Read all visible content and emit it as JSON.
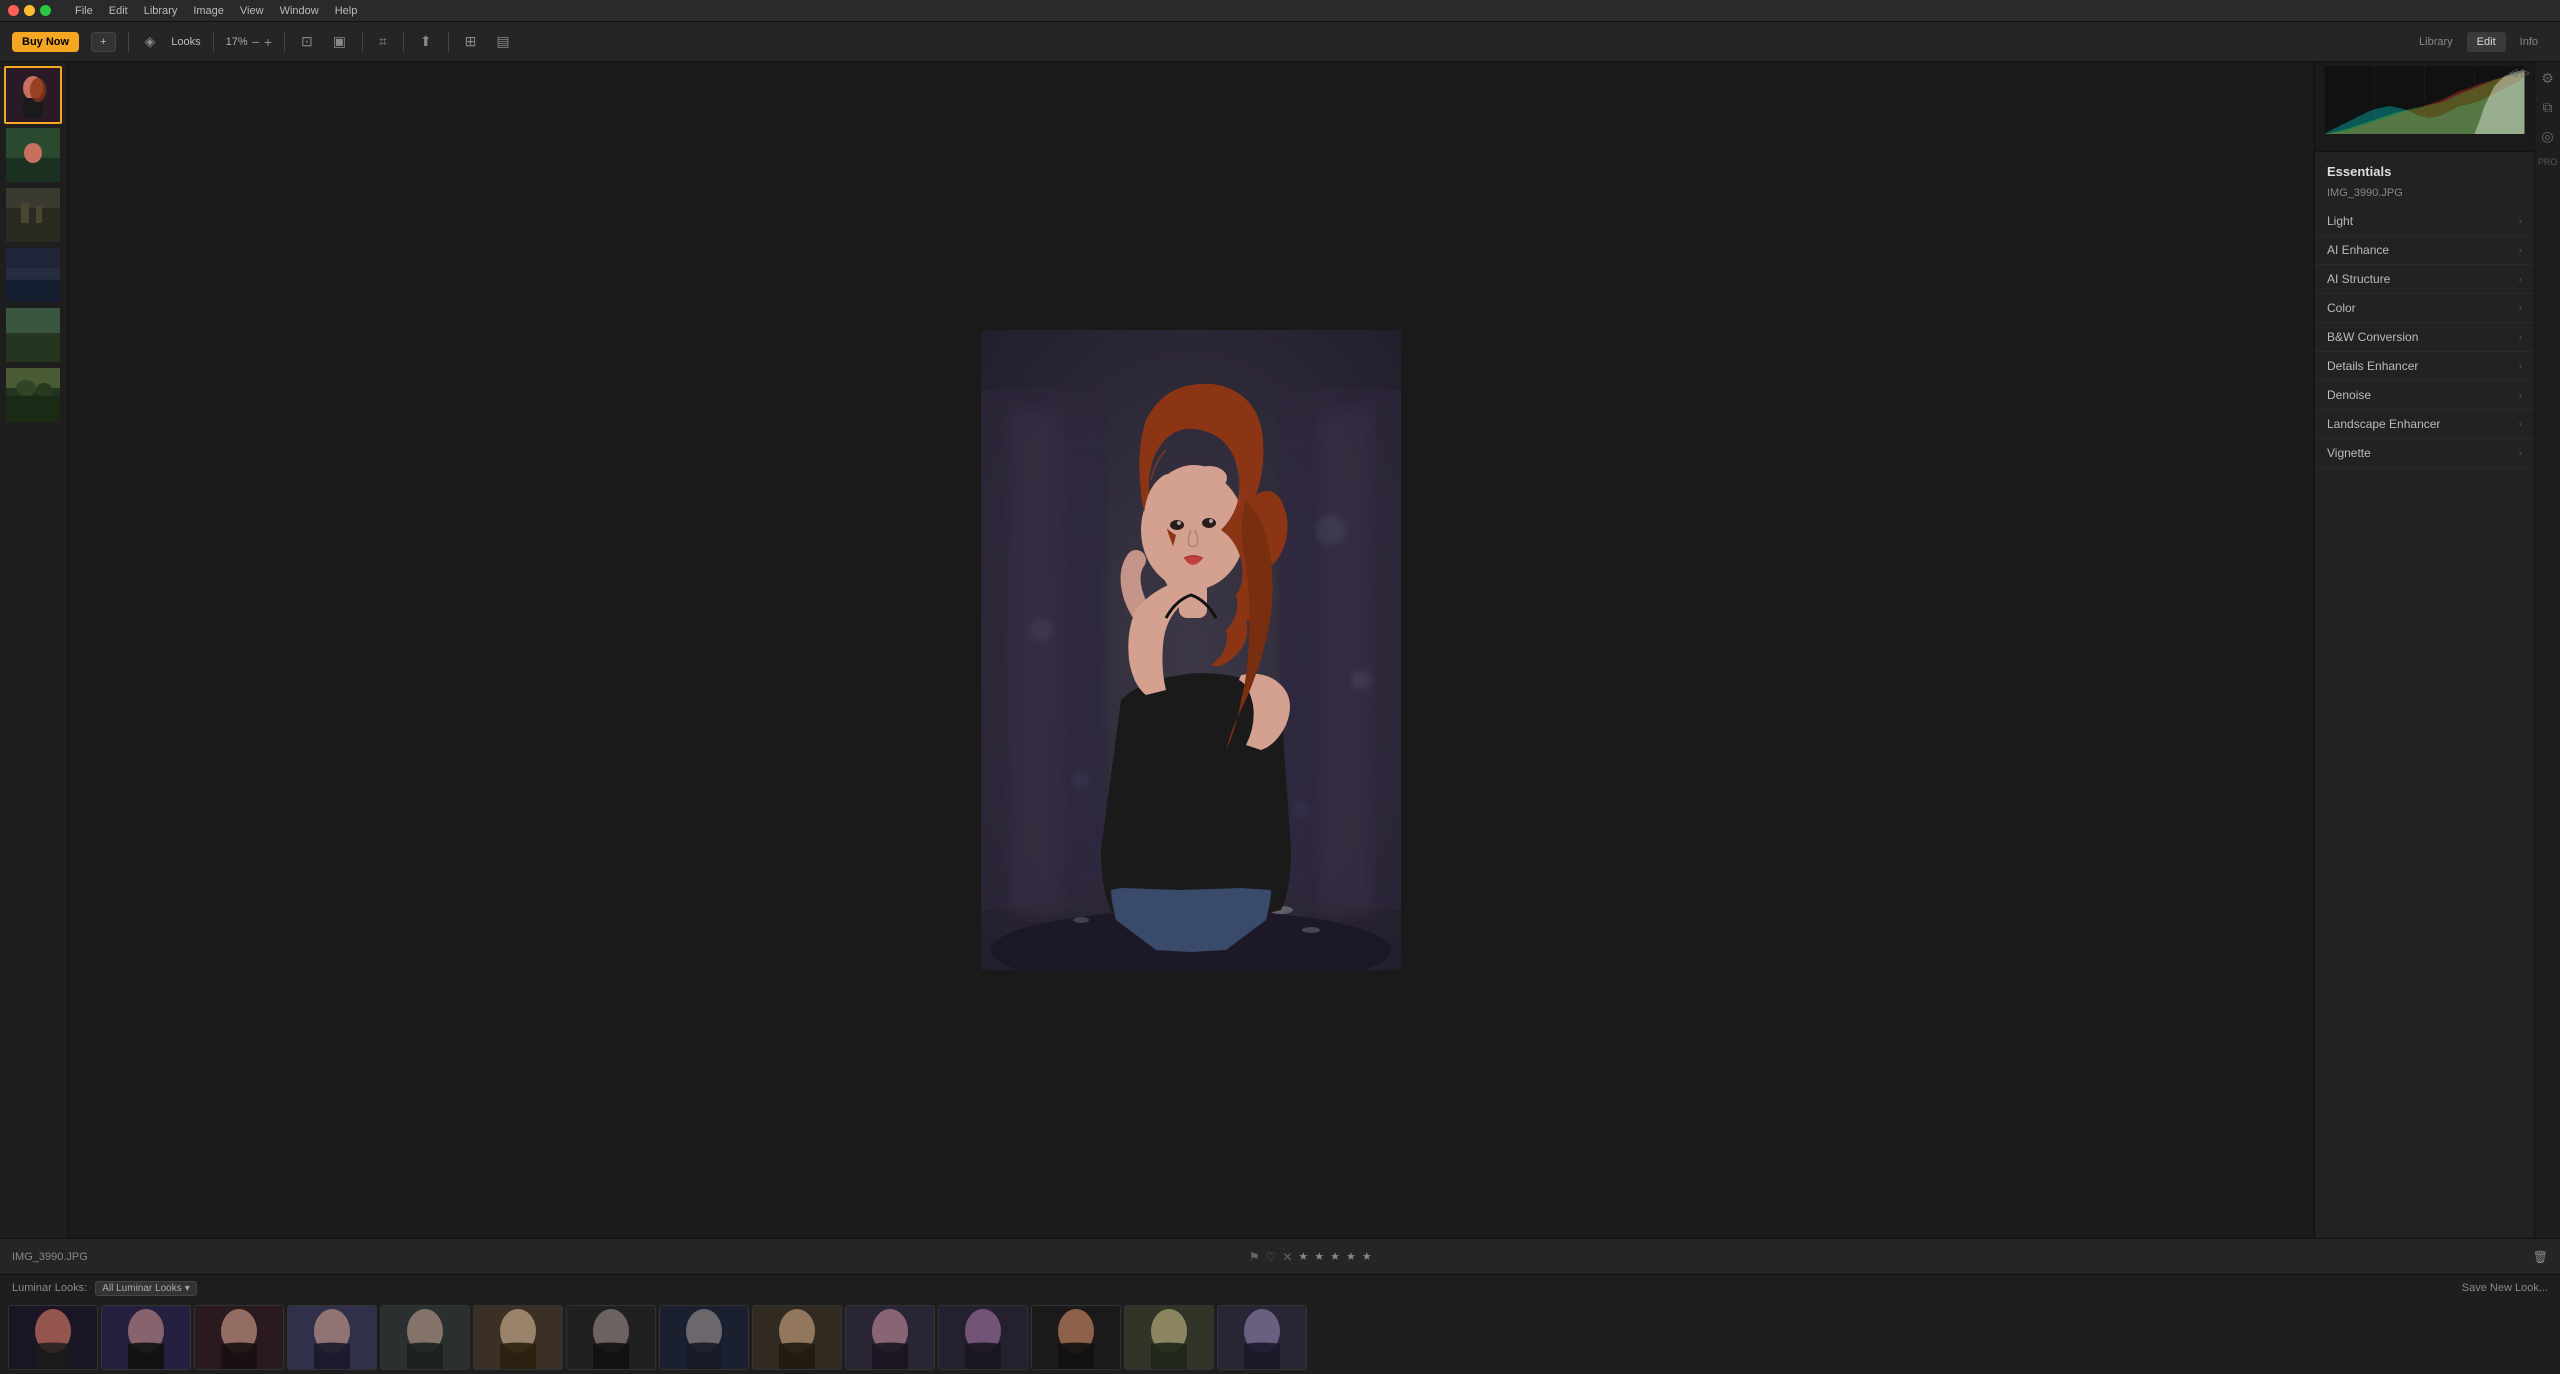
{
  "menubar": {
    "items": [
      "File",
      "Edit",
      "Library",
      "Image",
      "View",
      "Window",
      "Help"
    ]
  },
  "toolbar": {
    "buy_now": "Buy Now",
    "add_icon": "+",
    "looks_label": "Looks",
    "zoom_value": "17%",
    "zoom_minus": "−",
    "zoom_plus": "+",
    "tabs": [
      "Library",
      "Edit",
      "Info"
    ],
    "active_tab": "Edit"
  },
  "filmstrip": {
    "thumbnails": [
      {
        "id": 1,
        "label": "portrait1",
        "active": true,
        "bg": "#2a2535"
      },
      {
        "id": 2,
        "label": "portrait2",
        "active": false,
        "bg": "#254025"
      },
      {
        "id": 3,
        "label": "landscape1",
        "active": false,
        "bg": "#303530"
      },
      {
        "id": 4,
        "label": "landscape2",
        "active": false,
        "bg": "#252530"
      },
      {
        "id": 5,
        "label": "landscape3",
        "active": false,
        "bg": "#253025"
      },
      {
        "id": 6,
        "label": "landscape4",
        "active": false,
        "bg": "#303530"
      }
    ]
  },
  "right_panel": {
    "section_title": "Essentials",
    "filename": "IMG_3990.JPG",
    "items": [
      {
        "label": "Light",
        "has_chevron": true
      },
      {
        "label": "AI Enhance",
        "has_chevron": true
      },
      {
        "label": "AI Structure",
        "has_chevron": true
      },
      {
        "label": "Color",
        "has_chevron": true
      },
      {
        "label": "B&W Conversion",
        "has_chevron": true
      },
      {
        "label": "Details Enhancer",
        "has_chevron": true
      },
      {
        "label": "Denoise",
        "has_chevron": true
      },
      {
        "label": "Landscape Enhancer",
        "has_chevron": true
      },
      {
        "label": "Vignette",
        "has_chevron": true
      }
    ]
  },
  "bottom_bar": {
    "filename": "IMG_3990.JPG",
    "flag_icon": "⚑",
    "heart_icon": "♡",
    "reject_icon": "✕",
    "stars": [
      "★",
      "★",
      "★",
      "★",
      "★"
    ],
    "delete_icon": "🗑"
  },
  "looks_strip": {
    "label": "Luminar Looks:",
    "filter_btn": "All Luminar Looks",
    "filter_arrow": "▾",
    "save_btn": "Save New Look...",
    "thumbnails_count": 14
  },
  "colors": {
    "accent": "#f5a623",
    "bg_dark": "#1a1a1a",
    "bg_panel": "#222222",
    "bg_toolbar": "#252525",
    "text_primary": "#cccccc",
    "text_secondary": "#888888",
    "border": "#111111"
  }
}
